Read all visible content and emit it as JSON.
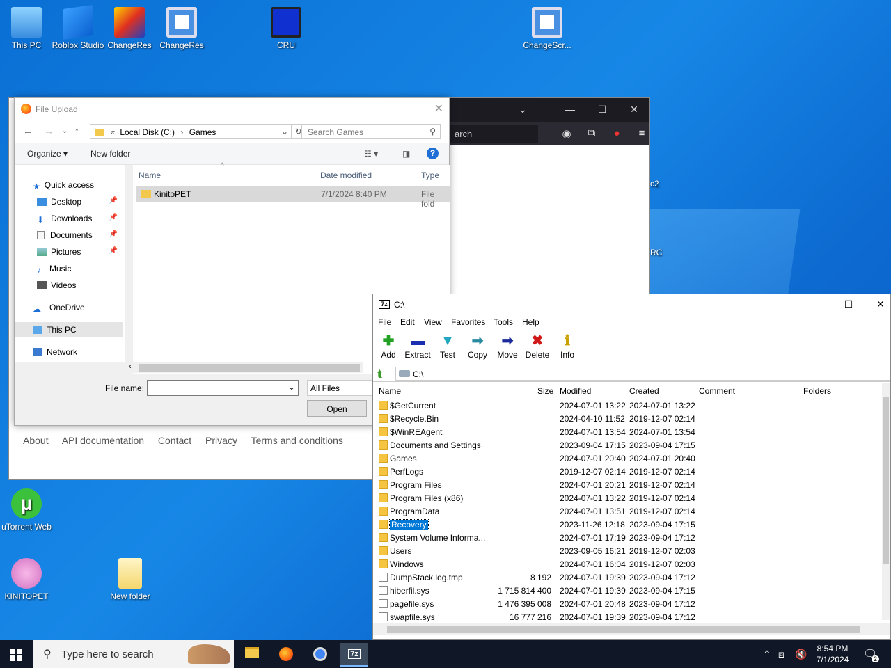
{
  "desktop": {
    "icons": [
      {
        "label": "This PC"
      },
      {
        "label": "Roblox Studio"
      },
      {
        "label": "ChangeRes"
      },
      {
        "label": "ChangeRes"
      },
      {
        "label": "CRU"
      },
      {
        "label": "ChangeScr..."
      },
      {
        "label": "uTorrent Web"
      },
      {
        "label": "KINITOPET"
      },
      {
        "label": "New folder"
      }
    ],
    "partial_labels": {
      "c2": "c2",
      "rc": "RC"
    }
  },
  "firefox": {
    "url_partial": "arch",
    "footer_links": [
      "About",
      "API documentation",
      "Contact",
      "Privacy",
      "Terms and conditions"
    ]
  },
  "upload_dialog": {
    "title": "File Upload",
    "breadcrumb": {
      "prefix": "«",
      "drive": "Local Disk (C:)",
      "sep": "›",
      "folder": "Games"
    },
    "search_placeholder": "Search Games",
    "organize": "Organize ▾",
    "new_folder": "New folder",
    "nav_items": [
      {
        "label": "Quick access",
        "icon": "star-icon",
        "pinned": false
      },
      {
        "label": "Desktop",
        "icon": "desktop-icon",
        "pinned": true
      },
      {
        "label": "Downloads",
        "icon": "download-icon",
        "pinned": true
      },
      {
        "label": "Documents",
        "icon": "document-icon",
        "pinned": true
      },
      {
        "label": "Pictures",
        "icon": "picture-icon",
        "pinned": true
      },
      {
        "label": "Music",
        "icon": "music-icon",
        "pinned": false
      },
      {
        "label": "Videos",
        "icon": "video-icon",
        "pinned": false
      },
      {
        "label": "OneDrive",
        "icon": "cloud-icon",
        "pinned": false
      },
      {
        "label": "This PC",
        "icon": "computer-icon",
        "pinned": false
      },
      {
        "label": "Network",
        "icon": "network-icon",
        "pinned": false
      }
    ],
    "columns": [
      "Name",
      "Date modified",
      "Type"
    ],
    "files": [
      {
        "name": "KinitoPET",
        "date": "7/1/2024 8:40 PM",
        "type": "File fold"
      }
    ],
    "file_name_label": "File name:",
    "file_name_value": "",
    "file_type": "All Files",
    "open_label": "Open"
  },
  "sevenzip": {
    "title": "C:\\",
    "menu": [
      "File",
      "Edit",
      "View",
      "Favorites",
      "Tools",
      "Help"
    ],
    "toolbar": [
      {
        "label": "Add",
        "glyph": "✚",
        "color": "#22a022"
      },
      {
        "label": "Extract",
        "glyph": "▬",
        "color": "#1a2fb0"
      },
      {
        "label": "Test",
        "glyph": "▼",
        "color": "#22a7c0"
      },
      {
        "label": "Copy",
        "glyph": "➡",
        "color": "#2a8aa0"
      },
      {
        "label": "Move",
        "glyph": "➡",
        "color": "#1a2a9a"
      },
      {
        "label": "Delete",
        "glyph": "✖",
        "color": "#d01818"
      },
      {
        "label": "Info",
        "glyph": "ℹ",
        "color": "#c8a000"
      }
    ],
    "path": "C:\\",
    "columns": [
      "Name",
      "Size",
      "Modified",
      "Created",
      "Comment",
      "Folders"
    ],
    "rows": [
      {
        "name": "$GetCurrent",
        "size": "",
        "modified": "2024-07-01 13:22",
        "created": "2024-07-01 13:22",
        "folder": true
      },
      {
        "name": "$Recycle.Bin",
        "size": "",
        "modified": "2024-04-10 11:52",
        "created": "2019-12-07 02:14",
        "folder": true
      },
      {
        "name": "$WinREAgent",
        "size": "",
        "modified": "2024-07-01 13:54",
        "created": "2024-07-01 13:54",
        "folder": true
      },
      {
        "name": "Documents and Settings",
        "size": "",
        "modified": "2023-09-04 17:15",
        "created": "2023-09-04 17:15",
        "folder": true
      },
      {
        "name": "Games",
        "size": "",
        "modified": "2024-07-01 20:40",
        "created": "2024-07-01 20:40",
        "folder": true
      },
      {
        "name": "PerfLogs",
        "size": "",
        "modified": "2019-12-07 02:14",
        "created": "2019-12-07 02:14",
        "folder": true
      },
      {
        "name": "Program Files",
        "size": "",
        "modified": "2024-07-01 20:21",
        "created": "2019-12-07 02:14",
        "folder": true
      },
      {
        "name": "Program Files (x86)",
        "size": "",
        "modified": "2024-07-01 13:22",
        "created": "2019-12-07 02:14",
        "folder": true
      },
      {
        "name": "ProgramData",
        "size": "",
        "modified": "2024-07-01 13:51",
        "created": "2019-12-07 02:14",
        "folder": true
      },
      {
        "name": "Recovery",
        "size": "",
        "modified": "2023-11-26 12:18",
        "created": "2023-09-04 17:15",
        "folder": true,
        "selected": true
      },
      {
        "name": "System Volume Informa...",
        "size": "",
        "modified": "2024-07-01 17:19",
        "created": "2023-09-04 17:12",
        "folder": true
      },
      {
        "name": "Users",
        "size": "",
        "modified": "2023-09-05 16:21",
        "created": "2019-12-07 02:03",
        "folder": true
      },
      {
        "name": "Windows",
        "size": "",
        "modified": "2024-07-01 16:04",
        "created": "2019-12-07 02:03",
        "folder": true
      },
      {
        "name": "DumpStack.log.tmp",
        "size": "8 192",
        "modified": "2024-07-01 19:39",
        "created": "2023-09-04 17:12",
        "folder": false
      },
      {
        "name": "hiberfil.sys",
        "size": "1 715 814 400",
        "modified": "2024-07-01 19:39",
        "created": "2023-09-04 17:15",
        "folder": false
      },
      {
        "name": "pagefile.sys",
        "size": "1 476 395 008",
        "modified": "2024-07-01 20:48",
        "created": "2023-09-04 17:12",
        "folder": false
      },
      {
        "name": "swapfile.sys",
        "size": "16 777 216",
        "modified": "2024-07-01 19:39",
        "created": "2023-09-04 17:12",
        "folder": false
      }
    ]
  },
  "taskbar": {
    "search_placeholder": "Type here to search",
    "time": "8:54 PM",
    "date": "7/1/2024",
    "notification_count": "2"
  }
}
